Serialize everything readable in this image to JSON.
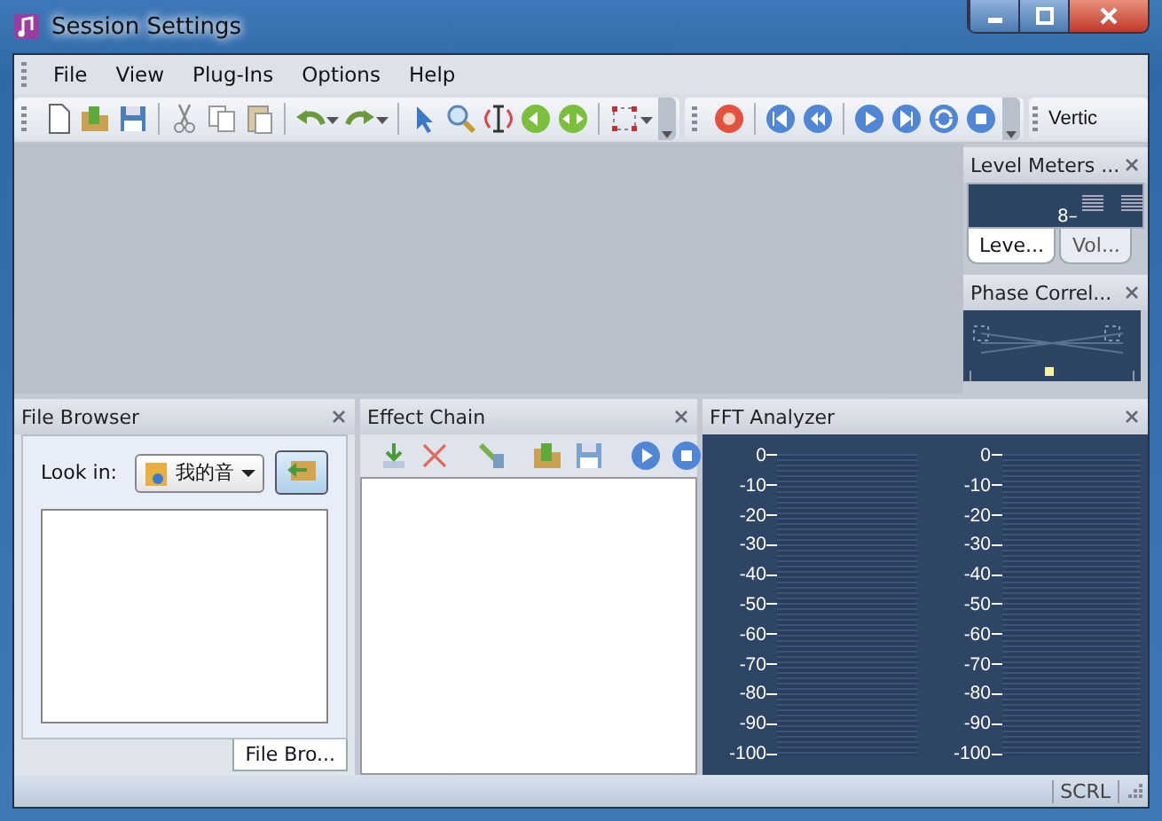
{
  "window": {
    "title": "Session Settings"
  },
  "menu": [
    "File",
    "View",
    "Plug-Ins",
    "Options",
    "Help"
  ],
  "toolbar_label": "Vertic",
  "level_meters": {
    "title": "Level Meters ...",
    "reading": "8–",
    "tabs": [
      {
        "label": "Leve...",
        "selected": true
      },
      {
        "label": "Vol...",
        "selected": false
      }
    ]
  },
  "phase_correlation": {
    "title": "Phase Correl..."
  },
  "file_browser": {
    "title": "File Browser",
    "look_in_label": "Look in:",
    "folder": "我的音",
    "tabs": [
      {
        "label": "File Bro...",
        "selected": true
      }
    ]
  },
  "effect_chain": {
    "title": "Effect Chain"
  },
  "fft_analyzer": {
    "title": "FFT Analyzer",
    "scales": [
      {
        "labels": [
          "0",
          "-10",
          "-20",
          "-30",
          "-40",
          "-50",
          "-60",
          "-70",
          "-80",
          "-90",
          "-100"
        ]
      },
      {
        "labels": [
          "0",
          "-10",
          "-20",
          "-30",
          "-40",
          "-50",
          "-60",
          "-70",
          "-80",
          "-90",
          "-100"
        ]
      }
    ]
  },
  "status_bar": {
    "indicator": "SCRL"
  }
}
